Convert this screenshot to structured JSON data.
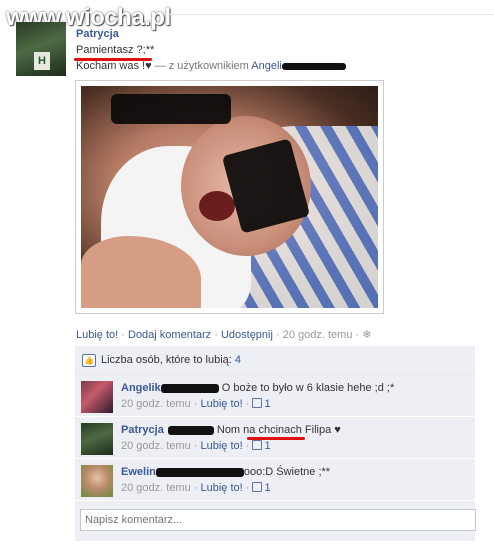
{
  "watermark": "www.wiocha.pl",
  "post": {
    "author": "Patrycja",
    "text": "Pamientasz ?;**",
    "with_text": "Kocham was !♥",
    "with_prefix": "— z użytkownikiem",
    "with_user": "Angeli"
  },
  "actions": {
    "like": "Lubię to!",
    "comment": "Dodaj komentarz",
    "share": "Udostępnij",
    "time": "20 godz. temu",
    "separator": "·"
  },
  "likes": {
    "label": "Liczba osób, które to lubią:",
    "count": "4"
  },
  "comments": [
    {
      "name": "Angelik",
      "text": "O boże to było w 6 klasie hehe ;d ;*",
      "time": "20 godz. temu",
      "like": "Lubię to!",
      "likes": "1"
    },
    {
      "name": "Patrycja",
      "text": "Nom na chcinach Filipa ♥",
      "time": "20 godz. temu",
      "like": "Lubię to!",
      "likes": "1"
    },
    {
      "name": "Ewelin",
      "text": "ooo:D Świetne ;**",
      "time": "20 godz. temu",
      "like": "Lubię to!",
      "likes": "1"
    }
  ],
  "comment_input": {
    "placeholder": "Napisz komentarz..."
  },
  "colors": {
    "link": "#3b5998",
    "bg_comments": "#edeff4",
    "underline": "#e01010"
  }
}
